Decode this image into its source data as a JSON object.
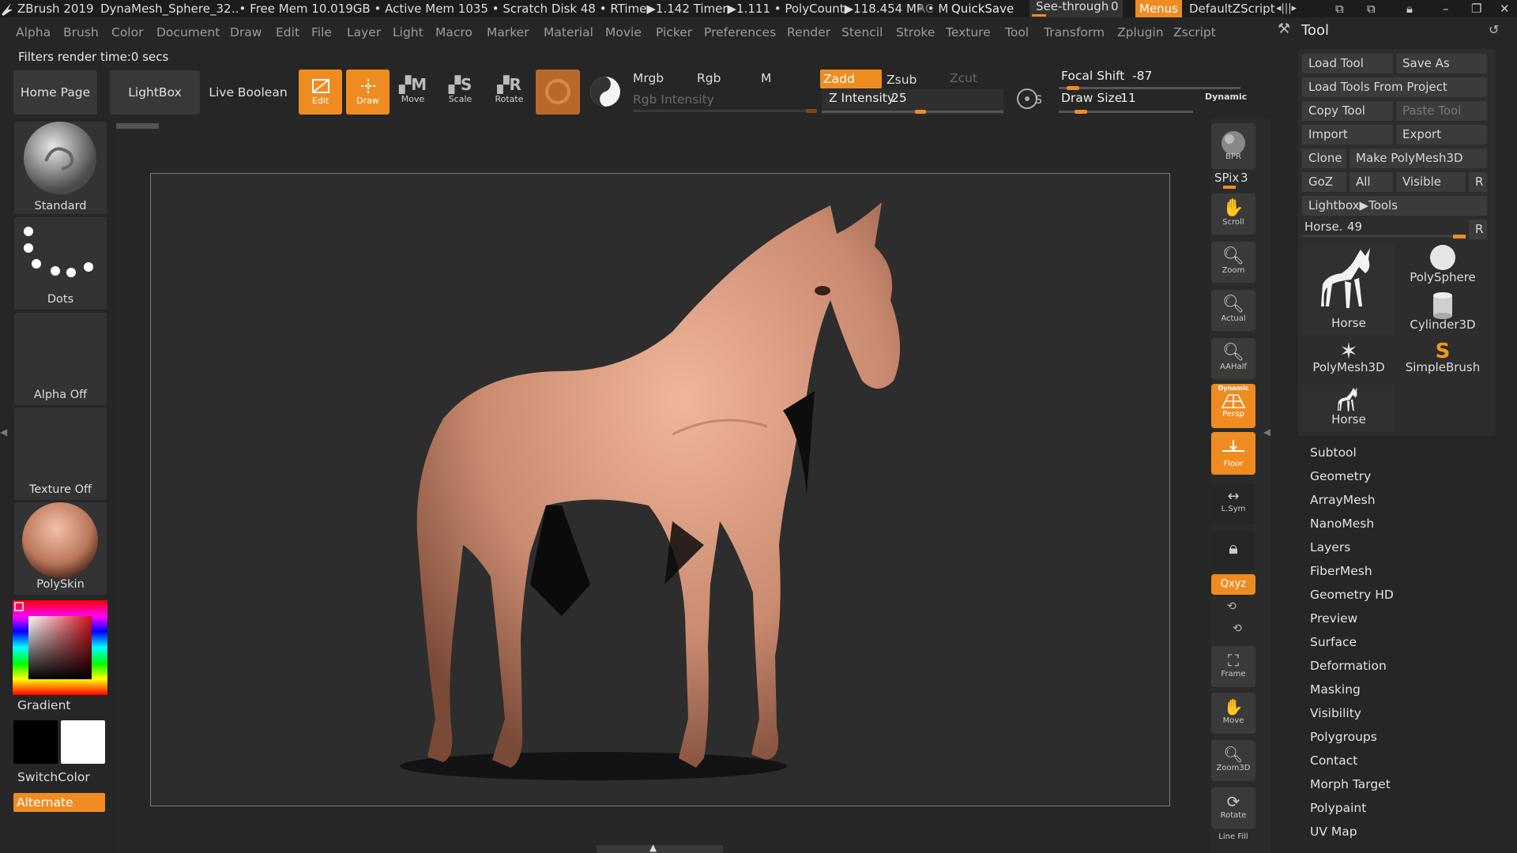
{
  "titlebar": {
    "app": "ZBrush 2019",
    "doc": "DynaMesh_Sphere_32",
    "stats": "..• Free Mem 10.019GB • Active Mem 1035 • Scratch Disk 48 • RTime▶1.142 Timer▶1.111 • PolyCount▶118.454 MP • M",
    "ac": "AC",
    "quicksave": "QuickSave",
    "seethrough": "See-through",
    "seethrough_value": "0",
    "menus": "Menus",
    "script": "DefaultZScript"
  },
  "menubar": [
    "Alpha",
    "Brush",
    "Color",
    "Document",
    "Draw",
    "Edit",
    "File",
    "Layer",
    "Light",
    "Macro",
    "Marker",
    "Material",
    "Movie",
    "Picker",
    "Preferences",
    "Render",
    "Stencil",
    "Stroke",
    "Texture",
    "Tool",
    "Transform",
    "Zplugin",
    "Zscript"
  ],
  "status": "Filters render time:0 secs",
  "toolbar": {
    "home": "Home Page",
    "lightbox": "LightBox",
    "live_boolean": "Live Boolean",
    "edit": "Edit",
    "draw": "Draw",
    "move": "Move",
    "scale": "Scale",
    "rotate": "Rotate",
    "mrgb": "Mrgb",
    "rgb": "Rgb",
    "m": "M",
    "zadd": "Zadd",
    "zsub": "Zsub",
    "zcut": "Zcut",
    "rgb_intensity": "Rgb Intensity",
    "z_intensity_label": "Z Intensity",
    "z_intensity": "25",
    "z_intensity_fraction": 0.25,
    "focal_shift_label": "Focal Shift",
    "focal_shift": "-87",
    "draw_size_label": "Draw Size",
    "draw_size": "11",
    "dynamic": "Dynamic",
    "s": "S"
  },
  "left_shelf": {
    "brush": "Standard",
    "stroke": "Dots",
    "alpha": "Alpha Off",
    "texture": "Texture Off",
    "material": "PolySkin",
    "gradient": "Gradient",
    "switchcolor": "SwitchColor",
    "alternate": "Alternate"
  },
  "right_shelf": {
    "bpr": "BPR",
    "spix_label": "SPix",
    "spix": "3",
    "scroll": "Scroll",
    "zoom": "Zoom",
    "actual": "Actual",
    "aahalf": "AAHalf",
    "persp_top": "Dynamic",
    "persp": "Persp",
    "floor": "Floor",
    "lsym": "L.Sym",
    "xyz": "Qxyz",
    "frame": "Frame",
    "move": "Move",
    "zoom3d": "Zoom3D",
    "rotate": "Rotate",
    "linefill": "Line Fill"
  },
  "tool_palette": {
    "title": "Tool",
    "load_tool": "Load Tool",
    "save_as": "Save As",
    "load_from_project": "Load Tools From Project",
    "copy_tool": "Copy Tool",
    "paste_tool": "Paste Tool",
    "import": "Import",
    "export": "Export",
    "clone": "Clone",
    "make_polymesh": "Make PolyMesh3D",
    "goz": "GoZ",
    "all": "All",
    "visible": "Visible",
    "r": "R",
    "lightbox_tools": "Lightbox▶Tools",
    "current_tool_label": "Horse.",
    "current_tool_value": "49",
    "thumbs": [
      "Horse",
      "PolySphere",
      "Cylinder3D",
      "PolyMesh3D",
      "SimpleBrush",
      "Horse"
    ],
    "sections": [
      "Subtool",
      "Geometry",
      "ArrayMesh",
      "NanoMesh",
      "Layers",
      "FiberMesh",
      "Geometry HD",
      "Preview",
      "Surface",
      "Deformation",
      "Masking",
      "Visibility",
      "Polygroups",
      "Contact",
      "Morph Target",
      "Polypaint",
      "UV Map"
    ]
  },
  "colors": {
    "accent": "#ef8c21",
    "background": "#262626",
    "model": "#d49a80"
  }
}
